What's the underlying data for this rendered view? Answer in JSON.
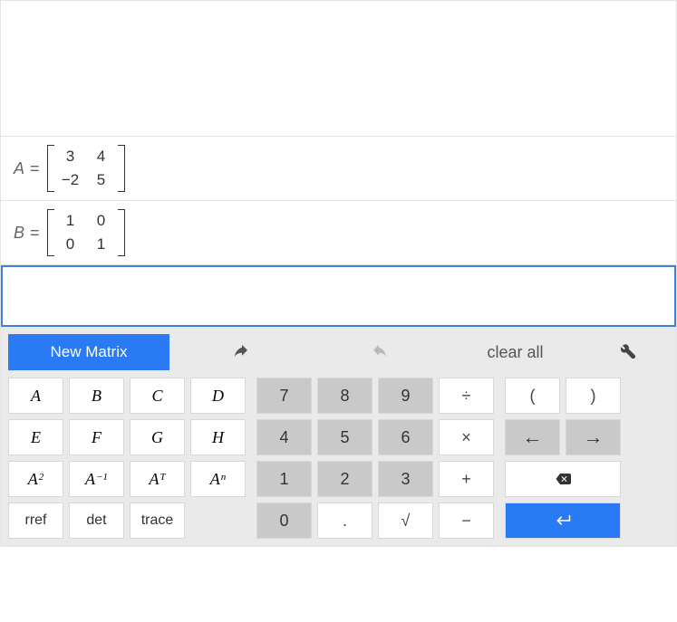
{
  "matrices": [
    {
      "name": "A",
      "rows": [
        [
          "3",
          "4"
        ],
        [
          "−2",
          "5"
        ]
      ]
    },
    {
      "name": "B",
      "rows": [
        [
          "1",
          "0"
        ],
        [
          "0",
          "1"
        ]
      ]
    }
  ],
  "toolbar": {
    "new_matrix": "New Matrix",
    "clear_all": "clear all"
  },
  "keys": {
    "letters": [
      "A",
      "B",
      "C",
      "D",
      "E",
      "F",
      "G",
      "H"
    ],
    "specials": {
      "sq": "A",
      "sq_sup": "2",
      "inv": "A",
      "inv_sup": "−1",
      "tr": "A",
      "tr_sup": "T",
      "pw": "A",
      "pw_sup": "n"
    },
    "funcs": {
      "rref": "rref",
      "det": "det",
      "trace": "trace"
    },
    "nums": [
      "7",
      "8",
      "9",
      "4",
      "5",
      "6",
      "1",
      "2",
      "3",
      "0"
    ],
    "dot": ".",
    "sqrt": "√",
    "ops": {
      "div": "÷",
      "mul": "×",
      "add": "+",
      "sub": "−"
    },
    "paren": {
      "open": "(",
      "close": ")"
    },
    "arrows": {
      "left": "←",
      "right": "→"
    },
    "backspace": "⌫",
    "enter": "↵"
  }
}
